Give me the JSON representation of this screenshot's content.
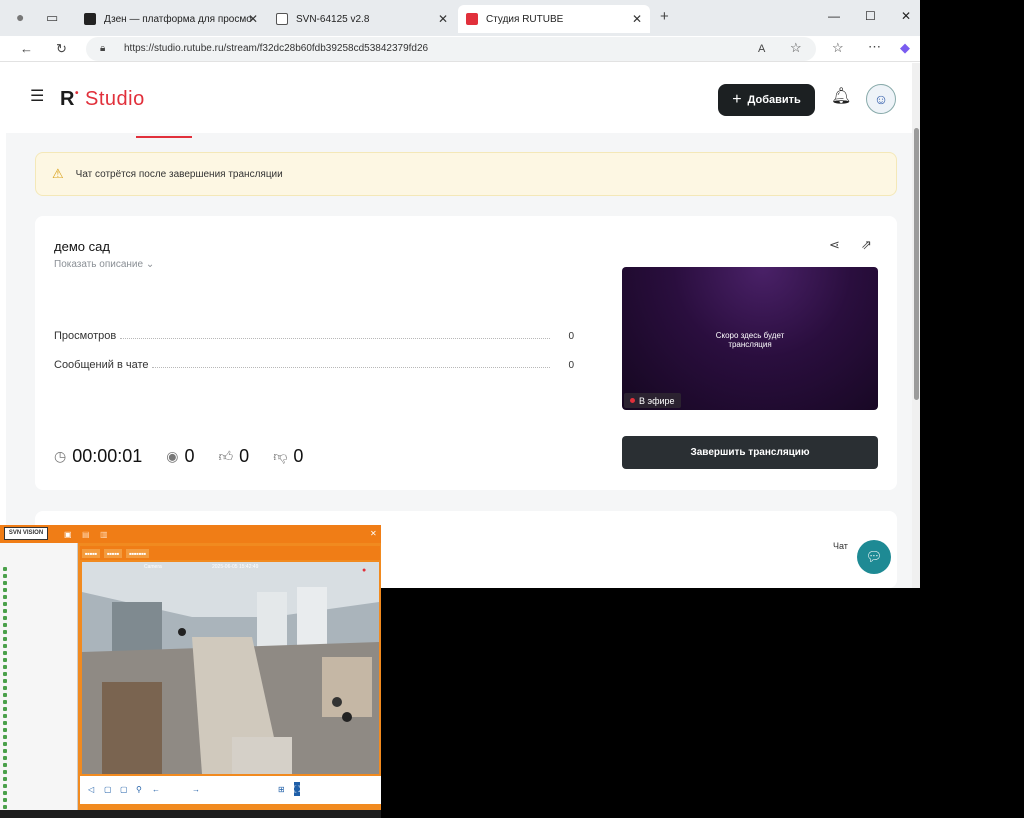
{
  "browser": {
    "tabs": [
      {
        "label": "Дзен — платформа для просмо",
        "favicon": "zen-icon"
      },
      {
        "label": "SVN-64125 v2.8",
        "favicon": "document-icon"
      },
      {
        "label": "Студия RUTUBE",
        "favicon": "rutube-icon"
      }
    ],
    "url": "https://studio.rutube.ru/stream/f32dc28b60fdb39258cd53842379fd26"
  },
  "header": {
    "brand_r": "R",
    "brand_studio": "Studio",
    "add_label": "Добавить"
  },
  "warning": {
    "text": "Чат сотрётся после завершения трансляции"
  },
  "stream": {
    "title": "демо сад",
    "show_description": "Показать описание",
    "stats": [
      {
        "label": "Просмотров",
        "value": "0"
      },
      {
        "label": "Сообщений в чате",
        "value": "0"
      }
    ],
    "duration": "00:00:01",
    "viewers": "0",
    "likes": "0",
    "dislikes": "0",
    "preview_text_line1": "Скоро здесь будет",
    "preview_text_line2": "трансляция",
    "live_label": "В эфире",
    "end_button": "Завершить трансляцию"
  },
  "chat": {
    "label": "Чат"
  },
  "camera_app": {
    "logo": "SVN VISION",
    "feed_label": "Camera",
    "timestamp": "2025-06-05 15:42:49"
  },
  "colors": {
    "accent": "#e1303b",
    "dark_button": "#1c2022",
    "camera_orange": "#f07d16",
    "chat_fab": "#1e8a94"
  }
}
